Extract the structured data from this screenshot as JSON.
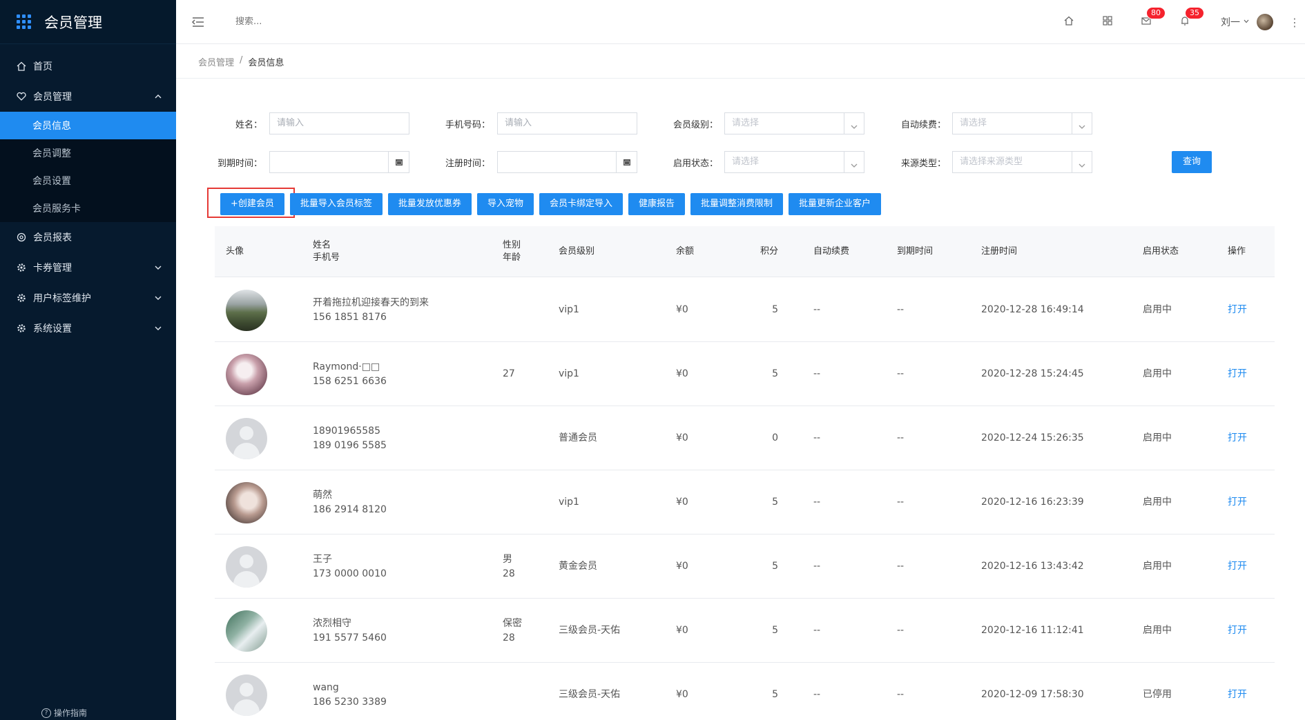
{
  "sidebar": {
    "title": "会员管理",
    "menu": [
      {
        "label": "首页"
      },
      {
        "label": "会员管理"
      },
      {
        "label": "会员报表"
      },
      {
        "label": "卡券管理"
      },
      {
        "label": "用户标签维护"
      },
      {
        "label": "系统设置"
      }
    ],
    "submenu": [
      {
        "label": "会员信息"
      },
      {
        "label": "会员调整"
      },
      {
        "label": "会员设置"
      },
      {
        "label": "会员服务卡"
      }
    ],
    "footer": "操作指南"
  },
  "header": {
    "search_placeholder": "搜索...",
    "mail_badge": "80",
    "bell_badge": "35",
    "user_name": "刘一"
  },
  "breadcrumb": {
    "parent": "会员管理",
    "sep": "/",
    "current": "会员信息"
  },
  "filters": {
    "name_label": "姓名：",
    "name_placeholder": "请输入",
    "phone_label": "手机号码：",
    "phone_placeholder": "请输入",
    "level_label": "会员级别：",
    "level_placeholder": "请选择",
    "renew_label": "自动续费：",
    "renew_placeholder": "请选择",
    "expire_label": "到期时间：",
    "register_label": "注册时间：",
    "status_label": "启用状态：",
    "status_placeholder": "请选择",
    "source_label": "来源类型：",
    "source_placeholder": "请选择来源类型",
    "query_button": "查询"
  },
  "actions": [
    "+创建会员",
    "批量导入会员标签",
    "批量发放优惠券",
    "导入宠物",
    "会员卡绑定导入",
    "健康报告",
    "批量调整消费限制",
    "批量更新企业客户"
  ],
  "table": {
    "headers": {
      "avatar": "头像",
      "name": "姓名",
      "phone": "手机号",
      "gender": "性别",
      "age": "年龄",
      "level": "会员级别",
      "balance": "余额",
      "points": "积分",
      "auto_renew": "自动续费",
      "expire": "到期时间",
      "register": "注册时间",
      "status": "启用状态",
      "op": "操作"
    },
    "rows": [
      {
        "avatar": "photo-mountain",
        "name": "开着拖拉机迎接春天的到来",
        "phone": "156 1851 8176",
        "gender": "",
        "age": "",
        "level": "vip1",
        "balance": "¥0",
        "points": "5",
        "auto_renew": "--",
        "expire": "--",
        "register": "2020-12-28 16:49:14",
        "status": "启用中",
        "op": "打开"
      },
      {
        "avatar": "photo-flower",
        "name": "Raymond·□□",
        "phone": "158 6251 6636",
        "gender": "",
        "age": "27",
        "level": "vip1",
        "balance": "¥0",
        "points": "5",
        "auto_renew": "--",
        "expire": "--",
        "register": "2020-12-28 15:24:45",
        "status": "启用中",
        "op": "打开"
      },
      {
        "avatar": "default",
        "name": "18901965585",
        "phone": "189 0196 5585",
        "gender": "",
        "age": "",
        "level": "普通会员",
        "balance": "¥0",
        "points": "0",
        "auto_renew": "--",
        "expire": "--",
        "register": "2020-12-24 15:26:35",
        "status": "启用中",
        "op": "打开"
      },
      {
        "avatar": "photo-portrait",
        "name": "萌然",
        "phone": "186 2914 8120",
        "gender": "",
        "age": "",
        "level": "vip1",
        "balance": "¥0",
        "points": "5",
        "auto_renew": "--",
        "expire": "--",
        "register": "2020-12-16 16:23:39",
        "status": "启用中",
        "op": "打开"
      },
      {
        "avatar": "default",
        "name": "王子",
        "phone": "173 0000 0010",
        "gender": "男",
        "age": "28",
        "level": "黄金会员",
        "balance": "¥0",
        "points": "5",
        "auto_renew": "--",
        "expire": "--",
        "register": "2020-12-16 13:43:42",
        "status": "启用中",
        "op": "打开"
      },
      {
        "avatar": "photo-wedding",
        "name": "浓烈相守",
        "phone": "191 5577 5460",
        "gender": "保密",
        "age": "28",
        "level": "三级会员-天佑",
        "balance": "¥0",
        "points": "5",
        "auto_renew": "--",
        "expire": "--",
        "register": "2020-12-16 11:12:41",
        "status": "启用中",
        "op": "打开"
      },
      {
        "avatar": "default",
        "name": "wang",
        "phone": "186 5230 3389",
        "gender": "",
        "age": "",
        "level": "三级会员-天佑",
        "balance": "¥0",
        "points": "5",
        "auto_renew": "--",
        "expire": "--",
        "register": "2020-12-09 17:58:30",
        "status": "已停用",
        "op": "打开"
      }
    ]
  },
  "colors": {
    "sidebar_bg": "#061a2e",
    "accent": "#1f8bf0",
    "badge": "#f5222d",
    "highlight": "#e53935"
  }
}
